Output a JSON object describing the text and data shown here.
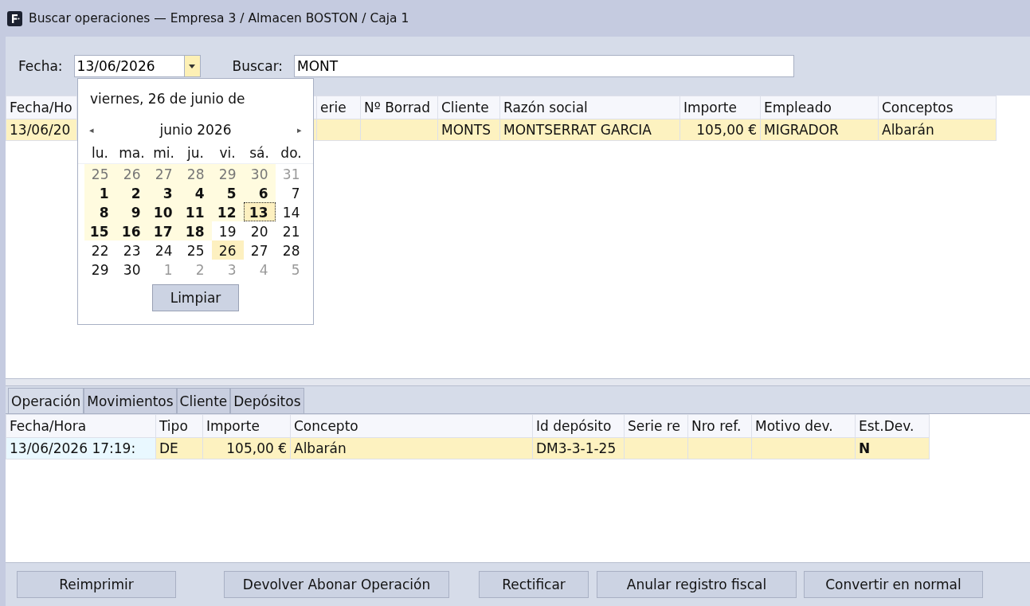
{
  "window": {
    "title": "Buscar operaciones — Empresa 3 / Almacen BOSTON / Caja 1"
  },
  "filter": {
    "date_label": "Fecha:",
    "date_value": "13/06/2026",
    "search_label": "Buscar:",
    "search_value": "MONT"
  },
  "calendar": {
    "header": "viernes, 26 de junio de",
    "prev": "◂",
    "month": "junio 2026",
    "next": "▸",
    "weekdays": [
      "lu.",
      "ma.",
      "mi.",
      "ju.",
      "vi.",
      "sá.",
      "do."
    ],
    "weeks": [
      [
        {
          "text": "25",
          "outside": true,
          "bold": false,
          "in_range": true,
          "selected": false,
          "today": false
        },
        {
          "text": "26",
          "outside": true,
          "bold": false,
          "in_range": true,
          "selected": false,
          "today": false
        },
        {
          "text": "27",
          "outside": true,
          "bold": false,
          "in_range": true,
          "selected": false,
          "today": false
        },
        {
          "text": "28",
          "outside": true,
          "bold": false,
          "in_range": true,
          "selected": false,
          "today": false
        },
        {
          "text": "29",
          "outside": true,
          "bold": false,
          "in_range": true,
          "selected": false,
          "today": false
        },
        {
          "text": "30",
          "outside": true,
          "bold": false,
          "in_range": true,
          "selected": false,
          "today": false
        },
        {
          "text": "31",
          "outside": true,
          "bold": false,
          "in_range": false,
          "selected": false,
          "today": false
        }
      ],
      [
        {
          "text": "1",
          "outside": false,
          "bold": true,
          "in_range": true,
          "selected": false,
          "today": false
        },
        {
          "text": "2",
          "outside": false,
          "bold": true,
          "in_range": true,
          "selected": false,
          "today": false
        },
        {
          "text": "3",
          "outside": false,
          "bold": true,
          "in_range": true,
          "selected": false,
          "today": false
        },
        {
          "text": "4",
          "outside": false,
          "bold": true,
          "in_range": true,
          "selected": false,
          "today": false
        },
        {
          "text": "5",
          "outside": false,
          "bold": true,
          "in_range": true,
          "selected": false,
          "today": false
        },
        {
          "text": "6",
          "outside": false,
          "bold": true,
          "in_range": true,
          "selected": false,
          "today": false
        },
        {
          "text": "7",
          "outside": false,
          "bold": false,
          "in_range": false,
          "selected": false,
          "today": false
        }
      ],
      [
        {
          "text": "8",
          "outside": false,
          "bold": true,
          "in_range": true,
          "selected": false,
          "today": false
        },
        {
          "text": "9",
          "outside": false,
          "bold": true,
          "in_range": true,
          "selected": false,
          "today": false
        },
        {
          "text": "10",
          "outside": false,
          "bold": true,
          "in_range": true,
          "selected": false,
          "today": false
        },
        {
          "text": "11",
          "outside": false,
          "bold": true,
          "in_range": true,
          "selected": false,
          "today": false
        },
        {
          "text": "12",
          "outside": false,
          "bold": true,
          "in_range": true,
          "selected": false,
          "today": false
        },
        {
          "text": "13",
          "outside": false,
          "bold": true,
          "in_range": true,
          "selected": true,
          "today": false
        },
        {
          "text": "14",
          "outside": false,
          "bold": false,
          "in_range": false,
          "selected": false,
          "today": false
        }
      ],
      [
        {
          "text": "15",
          "outside": false,
          "bold": true,
          "in_range": true,
          "selected": false,
          "today": false
        },
        {
          "text": "16",
          "outside": false,
          "bold": true,
          "in_range": true,
          "selected": false,
          "today": false
        },
        {
          "text": "17",
          "outside": false,
          "bold": true,
          "in_range": true,
          "selected": false,
          "today": false
        },
        {
          "text": "18",
          "outside": false,
          "bold": true,
          "in_range": true,
          "selected": false,
          "today": false
        },
        {
          "text": "19",
          "outside": false,
          "bold": false,
          "in_range": false,
          "selected": false,
          "today": false
        },
        {
          "text": "20",
          "outside": false,
          "bold": false,
          "in_range": false,
          "selected": false,
          "today": false
        },
        {
          "text": "21",
          "outside": false,
          "bold": false,
          "in_range": false,
          "selected": false,
          "today": false
        }
      ],
      [
        {
          "text": "22",
          "outside": false,
          "bold": false,
          "in_range": false,
          "selected": false,
          "today": false
        },
        {
          "text": "23",
          "outside": false,
          "bold": false,
          "in_range": false,
          "selected": false,
          "today": false
        },
        {
          "text": "24",
          "outside": false,
          "bold": false,
          "in_range": false,
          "selected": false,
          "today": false
        },
        {
          "text": "25",
          "outside": false,
          "bold": false,
          "in_range": false,
          "selected": false,
          "today": false
        },
        {
          "text": "26",
          "outside": false,
          "bold": false,
          "in_range": false,
          "selected": false,
          "today": true
        },
        {
          "text": "27",
          "outside": false,
          "bold": false,
          "in_range": false,
          "selected": false,
          "today": false
        },
        {
          "text": "28",
          "outside": false,
          "bold": false,
          "in_range": false,
          "selected": false,
          "today": false
        }
      ],
      [
        {
          "text": "29",
          "outside": false,
          "bold": false,
          "in_range": false,
          "selected": false,
          "today": false
        },
        {
          "text": "30",
          "outside": false,
          "bold": false,
          "in_range": false,
          "selected": false,
          "today": false
        },
        {
          "text": "1",
          "outside": true,
          "bold": false,
          "in_range": false,
          "selected": false,
          "today": false
        },
        {
          "text": "2",
          "outside": true,
          "bold": false,
          "in_range": false,
          "selected": false,
          "today": false
        },
        {
          "text": "3",
          "outside": true,
          "bold": false,
          "in_range": false,
          "selected": false,
          "today": false
        },
        {
          "text": "4",
          "outside": true,
          "bold": false,
          "in_range": false,
          "selected": false,
          "today": false
        },
        {
          "text": "5",
          "outside": true,
          "bold": false,
          "in_range": false,
          "selected": false,
          "today": false
        }
      ]
    ],
    "clear_button": "Limpiar"
  },
  "operations_table": {
    "columns": [
      "Fecha/Ho",
      "",
      "erie",
      "Nº Borrad",
      "Cliente",
      "Razón social",
      "Importe",
      "Empleado",
      "Conceptos"
    ],
    "rows": [
      {
        "selected": true,
        "cells": [
          "13/06/20",
          "",
          "",
          "",
          "MONTS",
          "MONTSERRAT GARCIA",
          "105,00 €",
          "MIGRADOR",
          "Albarán"
        ]
      }
    ]
  },
  "tabs": [
    {
      "label": "Operación",
      "selected": true
    },
    {
      "label": "Movimientos",
      "selected": false
    },
    {
      "label": "Cliente",
      "selected": false
    },
    {
      "label": "Depósitos",
      "selected": false
    }
  ],
  "movements_table": {
    "columns": [
      "Fecha/Hora",
      "Tipo",
      "Importe",
      "Concepto",
      "Id depósito",
      "Serie re",
      "Nro ref.",
      "Motivo dev.",
      "Est.Dev."
    ],
    "rows": [
      {
        "selected": true,
        "cells": [
          "13/06/2026 17:19:",
          "DE",
          "105,00 €",
          "Albarán",
          "DM3-3-1-25",
          "",
          "",
          "",
          "N"
        ]
      }
    ]
  },
  "buttons": [
    "Reimprimir",
    "Devolver Abonar Operación",
    "Rectificar",
    "Anular registro fiscal",
    "Convertir en normal"
  ]
}
